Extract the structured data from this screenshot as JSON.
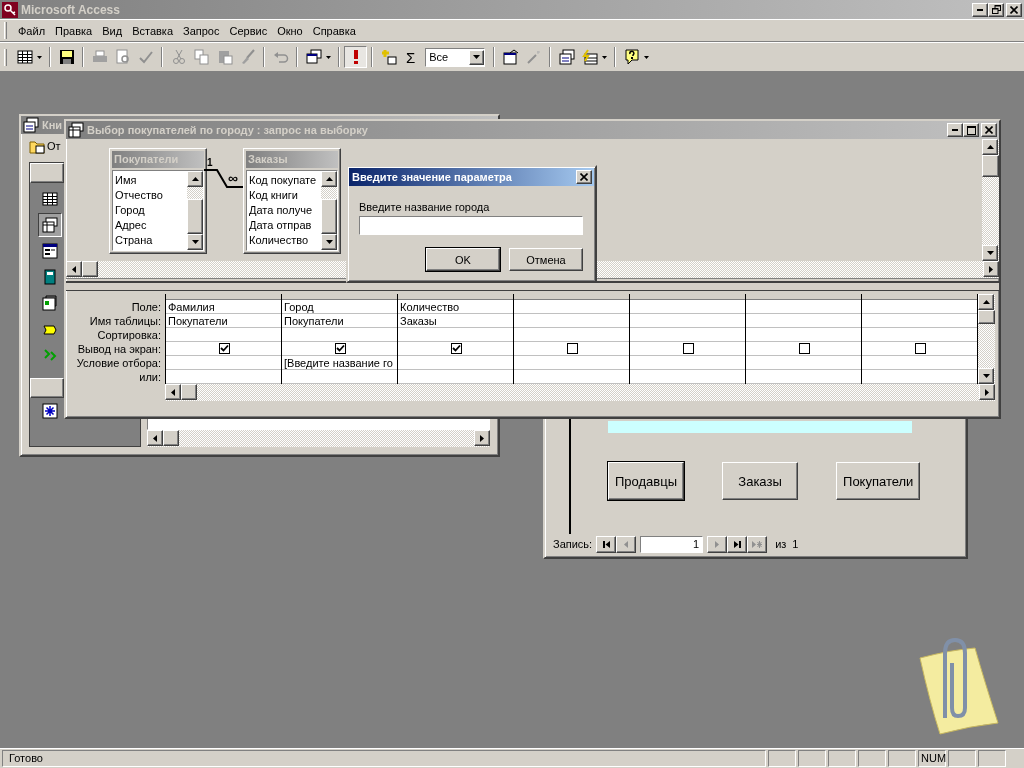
{
  "app": {
    "title": "Microsoft Access"
  },
  "menu": [
    "Файл",
    "Правка",
    "Вид",
    "Вставка",
    "Запрос",
    "Сервис",
    "Окно",
    "Справка"
  ],
  "toolbar": {
    "totals_symbol": "Σ",
    "top_values": "Все"
  },
  "back_window": {
    "title": "Кни",
    "open_button": "От"
  },
  "query_window": {
    "title": "Выбор покупателей по городу : запрос на выборку",
    "tables": [
      {
        "name": "Покупатели",
        "fields": [
          "Имя",
          "Отчество",
          "Город",
          "Адрес",
          "Страна"
        ]
      },
      {
        "name": "Заказы",
        "fields": [
          "Код покупате",
          "Код книги",
          "Дата получе",
          "Дата отправ",
          "Количество"
        ]
      }
    ],
    "relation": {
      "one": "1",
      "many": "∞"
    },
    "row_labels": [
      "Поле:",
      "Имя таблицы:",
      "Сортировка:",
      "Вывод на экран:",
      "Условие отбора:",
      "или:"
    ],
    "columns": [
      {
        "field": "Фамилия",
        "table": "Покупатели",
        "show": true
      },
      {
        "field": "Город",
        "table": "Покупатели",
        "show": true,
        "criteria": "[Введите название го"
      },
      {
        "field": "Количество",
        "table": "Заказы",
        "show": true
      },
      {
        "show": false
      },
      {
        "show": false
      },
      {
        "show": false
      },
      {
        "show": false
      }
    ]
  },
  "dialog": {
    "title": "Введите значение параметра",
    "prompt": "Введите название города",
    "buttons": [
      {
        "label": "OK",
        "default": true
      },
      {
        "label": "Отмена",
        "default": false
      }
    ]
  },
  "form": {
    "buttons": [
      {
        "label": "Продавцы",
        "focused": true
      },
      {
        "label": "Заказы",
        "focused": false
      },
      {
        "label": "Покупатели",
        "focused": false
      }
    ],
    "record_label": "Запись:",
    "current": "1",
    "of_label": "из",
    "total": "1"
  },
  "status_bar": {
    "text": "Готово",
    "indicator": "NUM"
  }
}
